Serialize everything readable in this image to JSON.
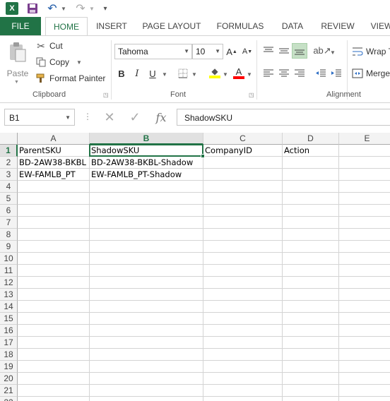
{
  "quick_access": {
    "app_icon": "excel-logo-icon",
    "app_letter": "X",
    "icons": [
      "save-icon",
      "undo-icon",
      "redo-icon",
      "customize-icon"
    ]
  },
  "tabs": {
    "file": "FILE",
    "home": "HOME",
    "insert": "INSERT",
    "page_layout": "PAGE LAYOUT",
    "formulas": "FORMULAS",
    "data": "DATA",
    "review": "REVIEW",
    "view": "VIEW"
  },
  "clipboard": {
    "paste": "Paste",
    "cut": "Cut",
    "copy": "Copy",
    "format_painter": "Format Painter",
    "group_label": "Clipboard"
  },
  "font": {
    "name": "Tahoma",
    "size": "10",
    "grow": "A",
    "shrink": "A",
    "bold": "B",
    "italic": "I",
    "underline": "U",
    "font_color_letter": "A",
    "group_label": "Font",
    "fill_color": "#ffff00",
    "font_color": "#ff0000"
  },
  "alignment": {
    "wrap_text": "Wrap T",
    "merge": "Merge",
    "group_label": "Alignment"
  },
  "formula_bar": {
    "name_box": "B1",
    "fx": "fx",
    "content": "ShadowSKU"
  },
  "grid": {
    "columns": [
      "A",
      "B",
      "C",
      "D",
      "E"
    ],
    "selected_column": "B",
    "selected_row": "1",
    "active_cell": "B1",
    "rows": [
      {
        "num": "1",
        "cells": [
          "ParentSKU",
          "ShadowSKU",
          "CompanyID",
          "Action",
          ""
        ]
      },
      {
        "num": "2",
        "cells": [
          "BD-2AW38-BKBL",
          "BD-2AW38-BKBL-Shadow",
          "",
          "",
          ""
        ]
      },
      {
        "num": "3",
        "cells": [
          "EW-FAMLB_PT",
          "EW-FAMLB_PT-Shadow",
          "",
          "",
          ""
        ]
      },
      {
        "num": "4",
        "cells": [
          "",
          "",
          "",
          "",
          ""
        ]
      },
      {
        "num": "5",
        "cells": [
          "",
          "",
          "",
          "",
          ""
        ]
      },
      {
        "num": "6",
        "cells": [
          "",
          "",
          "",
          "",
          ""
        ]
      },
      {
        "num": "7",
        "cells": [
          "",
          "",
          "",
          "",
          ""
        ]
      },
      {
        "num": "8",
        "cells": [
          "",
          "",
          "",
          "",
          ""
        ]
      },
      {
        "num": "9",
        "cells": [
          "",
          "",
          "",
          "",
          ""
        ]
      },
      {
        "num": "10",
        "cells": [
          "",
          "",
          "",
          "",
          ""
        ]
      },
      {
        "num": "11",
        "cells": [
          "",
          "",
          "",
          "",
          ""
        ]
      },
      {
        "num": "12",
        "cells": [
          "",
          "",
          "",
          "",
          ""
        ]
      },
      {
        "num": "13",
        "cells": [
          "",
          "",
          "",
          "",
          ""
        ]
      },
      {
        "num": "14",
        "cells": [
          "",
          "",
          "",
          "",
          ""
        ]
      },
      {
        "num": "15",
        "cells": [
          "",
          "",
          "",
          "",
          ""
        ]
      },
      {
        "num": "16",
        "cells": [
          "",
          "",
          "",
          "",
          ""
        ]
      },
      {
        "num": "17",
        "cells": [
          "",
          "",
          "",
          "",
          ""
        ]
      },
      {
        "num": "18",
        "cells": [
          "",
          "",
          "",
          "",
          ""
        ]
      },
      {
        "num": "19",
        "cells": [
          "",
          "",
          "",
          "",
          ""
        ]
      },
      {
        "num": "20",
        "cells": [
          "",
          "",
          "",
          "",
          ""
        ]
      },
      {
        "num": "21",
        "cells": [
          "",
          "",
          "",
          "",
          ""
        ]
      },
      {
        "num": "22",
        "cells": [
          "",
          "",
          "",
          "",
          ""
        ]
      }
    ]
  },
  "colors": {
    "excel_green": "#217346",
    "header_bg": "#f3f3f3",
    "gridline": "#d4d4d4"
  }
}
